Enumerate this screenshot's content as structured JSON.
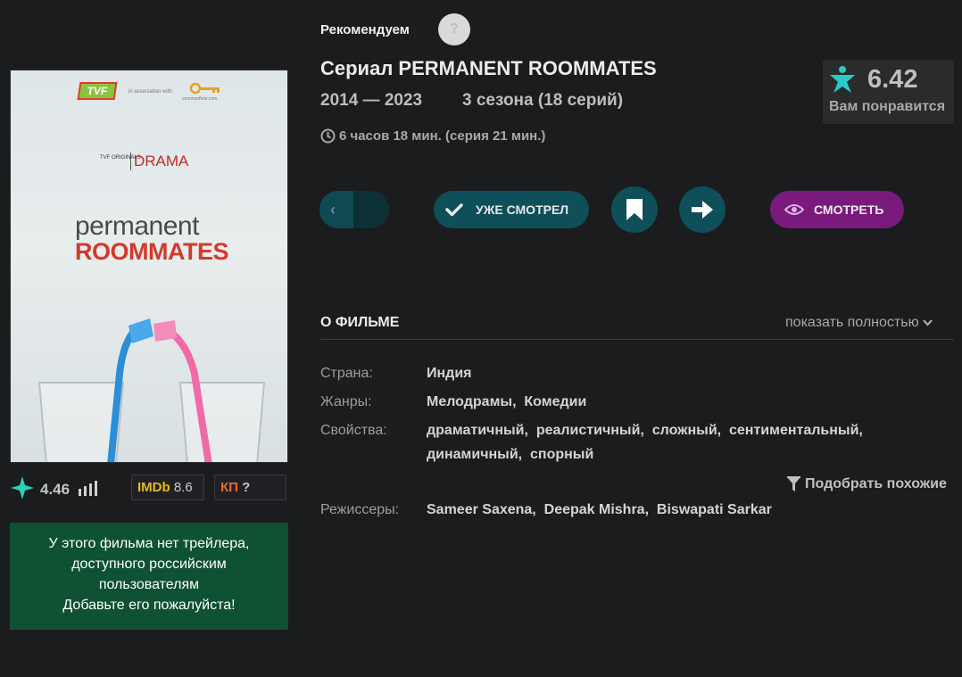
{
  "header": {
    "recommend_label": "Рекомендуем",
    "help_symbol": "?",
    "title": "Сериал PERMANENT ROOMMATES",
    "years": "2014 — 2023",
    "seasons": "3 сезона (18 серий)",
    "duration": "6 часов 18 мин. (серия 21 мин.)"
  },
  "score": {
    "value": "6.42",
    "subtitle": "Вам понравится",
    "icon": "person-star-icon"
  },
  "poster": {
    "tvf": "TVF",
    "in_association": "in association with",
    "commonfloor": "commonfloor.com",
    "tvf_originals": "TVF ORIGINALS",
    "drama": "DRAMA",
    "title_line1": "permanent",
    "title_line2": "ROOMMATES"
  },
  "ratings": {
    "site_value": "4.46",
    "imdb_label": "IMDb",
    "imdb_value": "8.6",
    "kp_label": "КП",
    "kp_value": "?"
  },
  "trailer": {
    "line1": "У этого фильма нет трейлера,",
    "line2": "доступного российским",
    "line3": "пользователям",
    "line4": "Добавьте его пожалуйста!"
  },
  "buttons": {
    "seen": "УЖЕ СМОТРЕЛ",
    "watch": "СМОТРЕТЬ"
  },
  "about": {
    "title": "О ФИЛЬМЕ",
    "show_full": "показать полностью",
    "country_label": "Страна:",
    "country": "Индия",
    "genres_label": "Жанры:",
    "genres": "Мелодрамы,  Комедии",
    "props_label": "Свойства:",
    "props_line1": "драматичный,  реалистичный,  сложный,  сентиментальный,",
    "props_line2": "динамичный,  спорный",
    "similar": "Подобрать похожие",
    "directors_label": "Режиссеры:",
    "directors": "Sameer Saxena,  Deepak Mishra,  Biswapati Sarkar"
  },
  "colors": {
    "background": "#1b1c1e",
    "teal_button": "#0e4f59",
    "watch_button": "#7b1a7d",
    "trailer_box": "#0e5133",
    "imdb": "#e6b91e",
    "kp": "#f26522"
  }
}
